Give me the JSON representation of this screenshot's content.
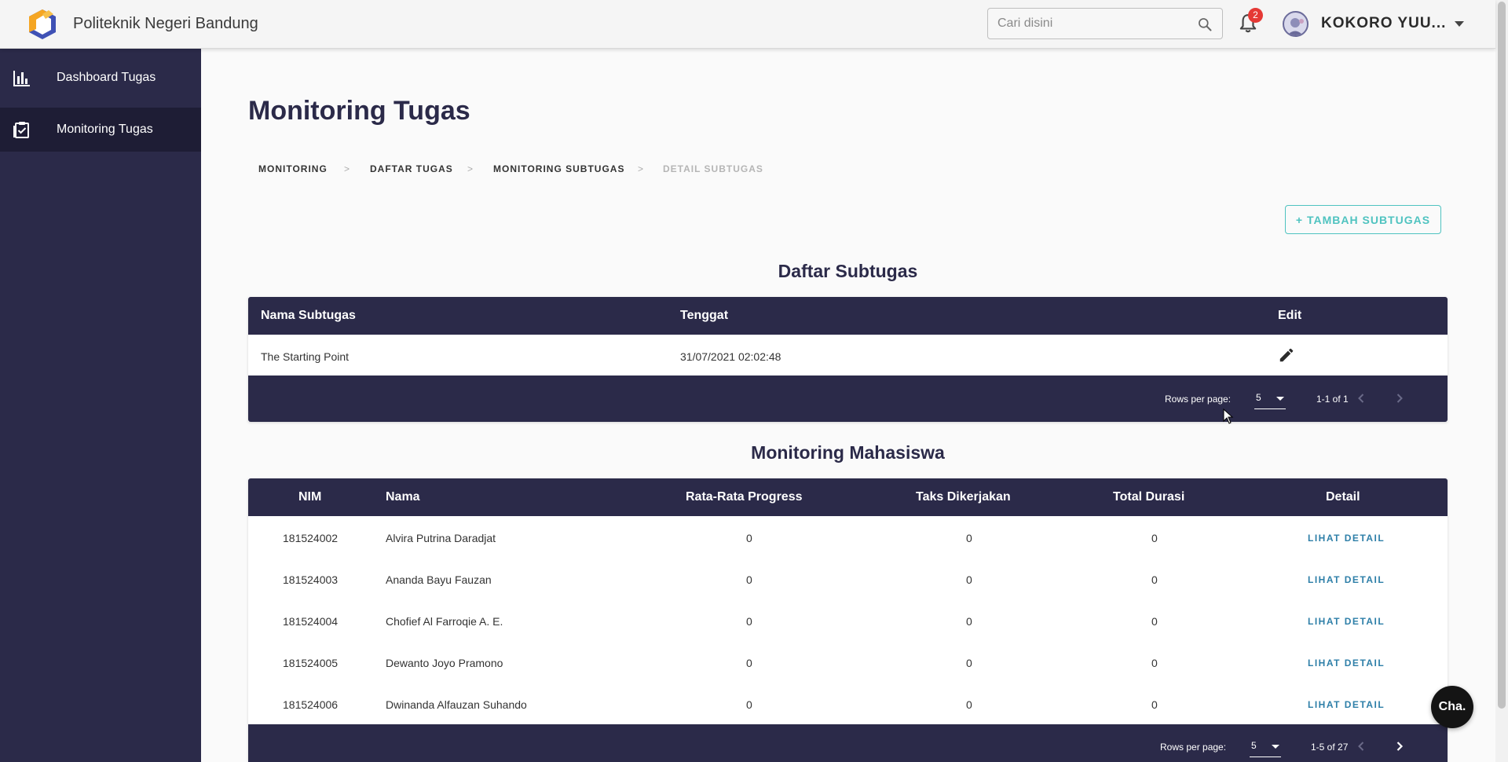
{
  "brand": {
    "name": "Politeknik Negeri Bandung",
    "logo_colors": [
      "#f5a623",
      "#3f51b5"
    ]
  },
  "header": {
    "search_placeholder": "Cari disini",
    "notification_count": "2",
    "username": "KOKORO YUU..."
  },
  "sidebar": {
    "items": [
      {
        "label": "Dashboard Tugas",
        "icon": "bar-chart-icon"
      },
      {
        "label": "Monitoring Tugas",
        "icon": "clipboard-check-icon"
      }
    ]
  },
  "page": {
    "title": "Monitoring Tugas",
    "breadcrumb": [
      "MONITORING",
      "DAFTAR TUGAS",
      "MONITORING SUBTUGAS",
      "DETAIL SUBTUGAS"
    ],
    "breadcrumb_separator": ">",
    "add_button": "+ TAMBAH SUBTUGAS"
  },
  "subtask_table": {
    "title": "Daftar Subtugas",
    "headers": [
      "Nama Subtugas",
      "Tenggat",
      "Edit"
    ],
    "rows": [
      {
        "name": "The Starting Point",
        "deadline": "31/07/2021 02:02:48"
      }
    ],
    "rows_per_page_label": "Rows per page:",
    "rows_per_page": "5",
    "range": "1-1 of 1"
  },
  "student_table": {
    "title": "Monitoring Mahasiswa",
    "headers": [
      "NIM",
      "Nama",
      "Rata-Rata Progress",
      "Taks Dikerjakan",
      "Total Durasi",
      "Detail"
    ],
    "rows": [
      {
        "nim": "181524002",
        "name": "Alvira Putrina Daradjat",
        "progress": "0",
        "tasks": "0",
        "duration": "0",
        "detail": "LIHAT DETAIL"
      },
      {
        "nim": "181524003",
        "name": "Ananda Bayu Fauzan",
        "progress": "0",
        "tasks": "0",
        "duration": "0",
        "detail": "LIHAT DETAIL"
      },
      {
        "nim": "181524004",
        "name": "Chofief Al Farroqie A. E.",
        "progress": "0",
        "tasks": "0",
        "duration": "0",
        "detail": "LIHAT DETAIL"
      },
      {
        "nim": "181524005",
        "name": "Dewanto Joyo Pramono",
        "progress": "0",
        "tasks": "0",
        "duration": "0",
        "detail": "LIHAT DETAIL"
      },
      {
        "nim": "181524006",
        "name": "Dwinanda Alfauzan Suhando",
        "progress": "0",
        "tasks": "0",
        "duration": "0",
        "detail": "LIHAT DETAIL"
      }
    ],
    "rows_per_page_label": "Rows per page:",
    "rows_per_page": "5",
    "range": "1-5 of 27"
  },
  "chat_label": "Cha.",
  "colors": {
    "primary": "#2b2a49",
    "accent": "#4fc3c0",
    "link": "#2e7fa8",
    "badge": "#e53935"
  }
}
